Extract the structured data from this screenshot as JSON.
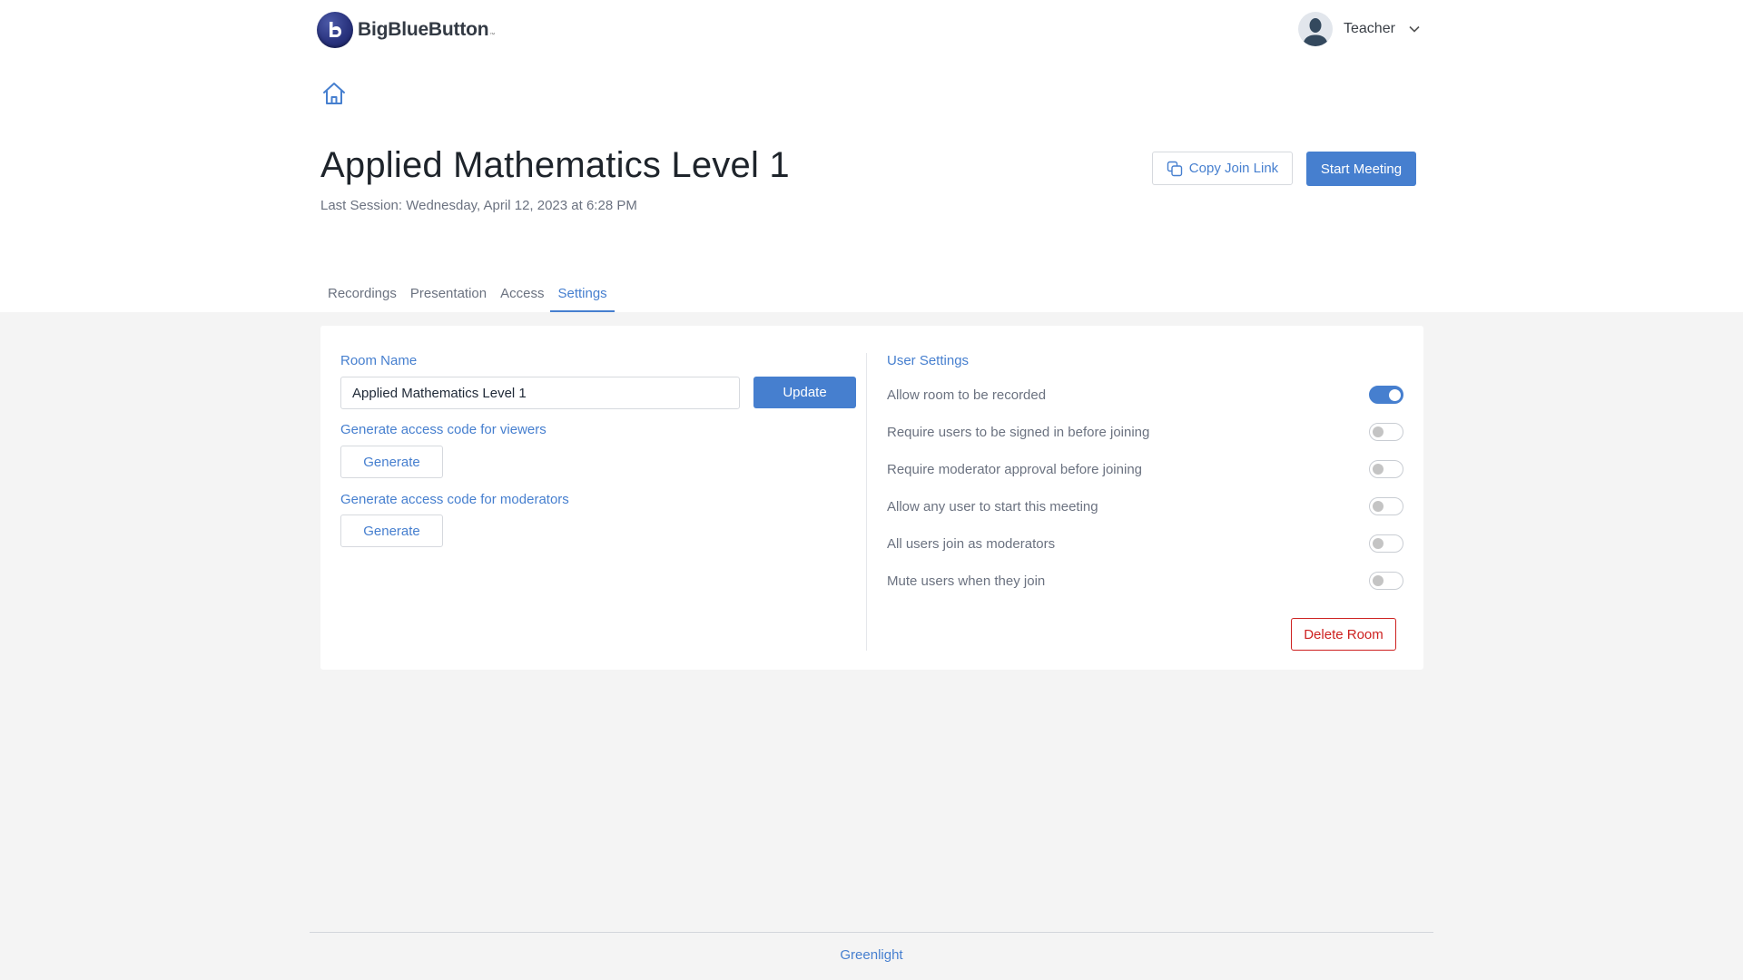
{
  "header": {
    "brand": "BigBlueButton",
    "brand_tm": "™",
    "user_name": "Teacher"
  },
  "room": {
    "title": "Applied Mathematics Level 1",
    "last_session": "Last Session: Wednesday, April 12, 2023 at 6:28 PM",
    "copy_join_link_label": "Copy Join Link",
    "start_meeting_label": "Start Meeting"
  },
  "tabs": [
    {
      "label": "Recordings",
      "active": false
    },
    {
      "label": "Presentation",
      "active": false
    },
    {
      "label": "Access",
      "active": false
    },
    {
      "label": "Settings",
      "active": true
    }
  ],
  "settings": {
    "room_name_label": "Room Name",
    "room_name_value": "Applied Mathematics Level 1",
    "update_label": "Update",
    "viewer_code_label": "Generate access code for viewers",
    "moderator_code_label": "Generate access code for moderators",
    "generate_label": "Generate",
    "user_settings_label": "User Settings",
    "options": [
      {
        "label": "Allow room to be recorded",
        "enabled": true
      },
      {
        "label": "Require users to be signed in before joining",
        "enabled": false
      },
      {
        "label": "Require moderator approval before joining",
        "enabled": false
      },
      {
        "label": "Allow any user to start this meeting",
        "enabled": false
      },
      {
        "label": "All users join as moderators",
        "enabled": false
      },
      {
        "label": "Mute users when they join",
        "enabled": false
      }
    ],
    "delete_room_label": "Delete Room"
  },
  "footer": {
    "link": "Greenlight"
  },
  "colors": {
    "accent": "#467fcf",
    "danger": "#cd201f",
    "page_bg": "#f4f4f4"
  }
}
